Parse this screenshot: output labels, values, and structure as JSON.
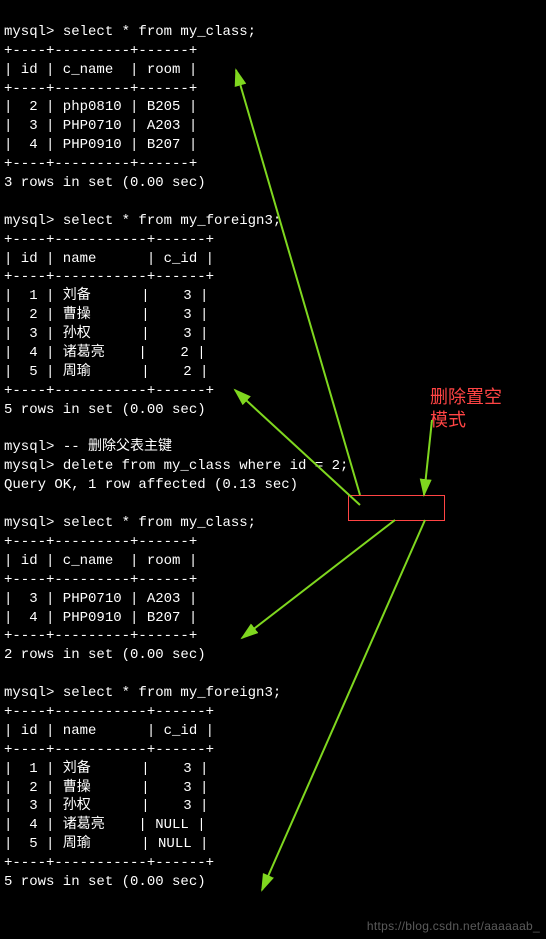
{
  "prompts": {
    "p": "mysql> "
  },
  "queries": {
    "select_class": "select * from my_class;",
    "select_foreign3": "select * from my_foreign3;",
    "comment_delete": "-- 删除父表主键",
    "delete_stmt": "delete from my_class where id = 2;"
  },
  "results": {
    "query_ok": "Query OK, 1 row affected (0.13 sec)",
    "rows3": "3 rows in set (0.00 sec)",
    "rows5": "5 rows in set (0.00 sec)",
    "rows2": "2 rows in set (0.00 sec)"
  },
  "class_table": {
    "sep": "+----+---------+------+",
    "hdr": "| id | c_name  | room |",
    "rows_before": [
      "|  2 | php0810 | B205 |",
      "|  3 | PHP0710 | A203 |",
      "|  4 | PHP0910 | B207 |"
    ],
    "rows_after": [
      "|  3 | PHP0710 | A203 |",
      "|  4 | PHP0910 | B207 |"
    ]
  },
  "foreign3_table": {
    "sep": "+----+-----------+------+",
    "hdr": "| id | name      | c_id |",
    "rows_before": [
      "|  1 | 刘备      |    3 |",
      "|  2 | 曹操      |    3 |",
      "|  3 | 孙权      |    3 |",
      "|  4 | 诸葛亮    |    2 |",
      "|  5 | 周瑜      |    2 |"
    ],
    "rows_after": [
      "|  1 | 刘备      |    3 |",
      "|  2 | 曹操      |    3 |",
      "|  3 | 孙权      |    3 |",
      "|  4 | 诸葛亮    | NULL |",
      "|  5 | 周瑜      | NULL |"
    ]
  },
  "annotation": {
    "line1": "删除置空",
    "line2": "模式"
  },
  "watermark": "https://blog.csdn.net/aaaaaab_"
}
